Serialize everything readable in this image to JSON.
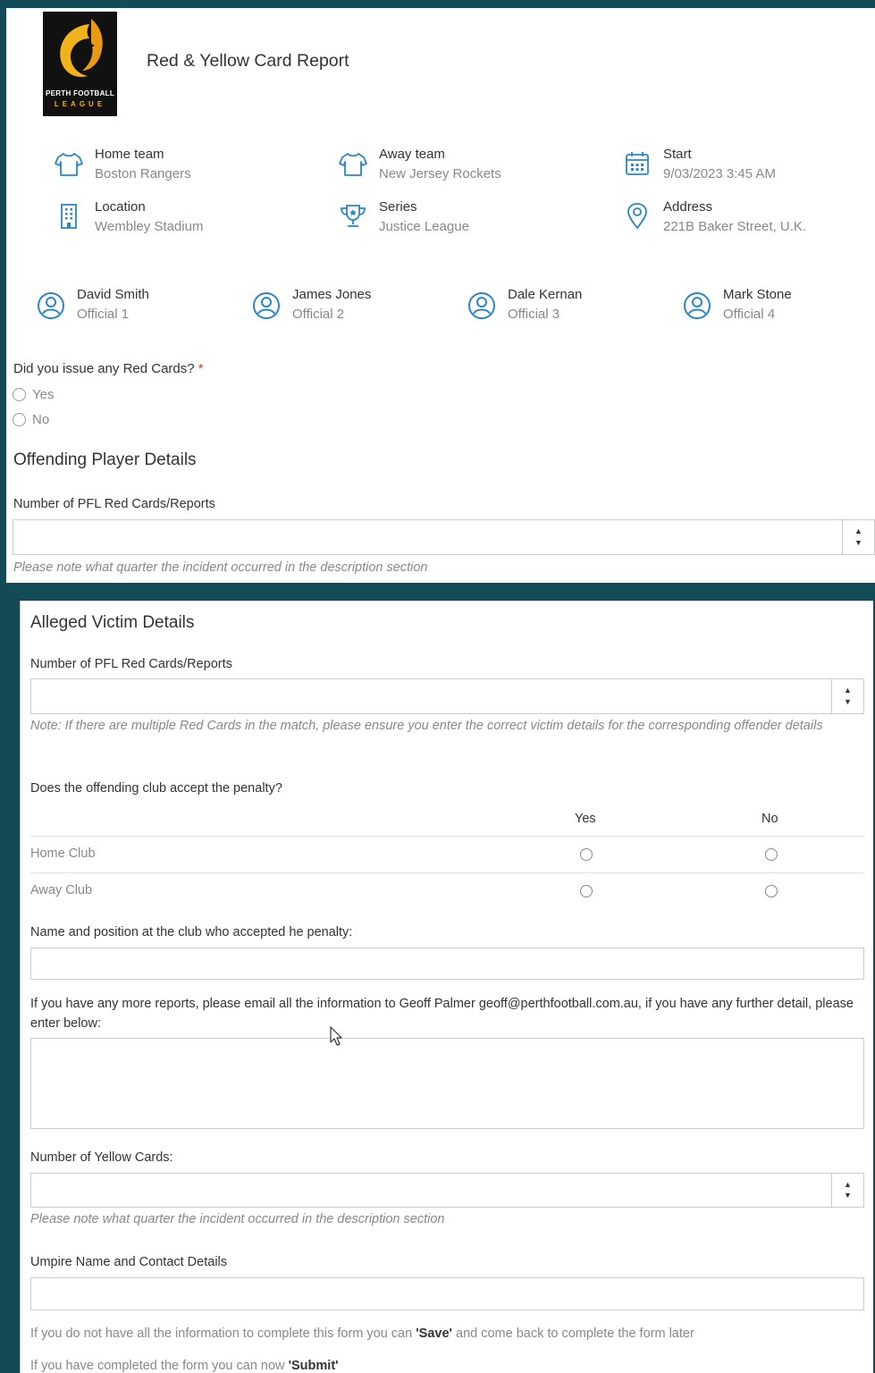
{
  "header": {
    "title": "Red & Yellow Card Report",
    "logo_line1": "PERTH FOOTBALL",
    "logo_line2": "LEAGUE"
  },
  "match_info": {
    "home_team": {
      "label": "Home team",
      "value": "Boston Rangers",
      "icon": "shirt-icon"
    },
    "away_team": {
      "label": "Away team",
      "value": "New Jersey Rockets",
      "icon": "shirt-icon"
    },
    "start": {
      "label": "Start",
      "value": "9/03/2023 3:45 AM",
      "icon": "calendar-icon"
    },
    "location": {
      "label": "Location",
      "value": "Wembley Stadium",
      "icon": "building-icon"
    },
    "series": {
      "label": "Series",
      "value": "Justice League",
      "icon": "trophy-icon"
    },
    "address": {
      "label": "Address",
      "value": "221B Baker Street, U.K.",
      "icon": "map-pin-icon"
    }
  },
  "officials": [
    {
      "name": "David Smith",
      "role": "Official 1"
    },
    {
      "name": "James Jones",
      "role": "Official 2"
    },
    {
      "name": "Dale Kernan",
      "role": "Official 3"
    },
    {
      "name": "Mark Stone",
      "role": "Official 4"
    }
  ],
  "red_cards_question": {
    "label": "Did you issue any Red Cards?",
    "required_mark": "*",
    "options": [
      "Yes",
      "No"
    ]
  },
  "offending": {
    "title": "Offending Player Details",
    "field_label": "Number of PFL Red Cards/Reports",
    "value": "",
    "note": "Please note what quarter the incident occurred in the description section"
  },
  "victim": {
    "title": "Alleged Victim Details",
    "field_label": "Number of PFL Red Cards/Reports",
    "value": "",
    "note": "Note: If there are multiple Red Cards in the match, please ensure you enter the correct victim details for the corresponding offender details"
  },
  "penalty": {
    "question": "Does the offending club accept the penalty?",
    "columns": [
      "Yes",
      "No"
    ],
    "rows": [
      "Home Club",
      "Away Club"
    ]
  },
  "accepted_by": {
    "label": "Name and position at the club who accepted he penalty:",
    "value": ""
  },
  "more_reports": {
    "label": "If you have any more reports, please email all the information to Geoff Palmer geoff@perthfootball.com.au, if you have any further detail, please enter below:",
    "value": ""
  },
  "yellow_cards": {
    "label": "Number of Yellow Cards:",
    "value": "",
    "note": "Please note what quarter the incident occurred in the description section"
  },
  "umpire": {
    "label": "Umpire Name and Contact Details",
    "value": ""
  },
  "footer": {
    "save_pre": "If you do not have all the information to complete this form you can ",
    "save_word": "'Save'",
    "save_post": " and come back to complete the form later",
    "submit_pre": "If you have completed the form you can now ",
    "submit_word": "'Submit'"
  },
  "colors": {
    "background": "#144a55",
    "icon_blue": "#2a86c9",
    "logo_orange": "#f2b21b"
  }
}
